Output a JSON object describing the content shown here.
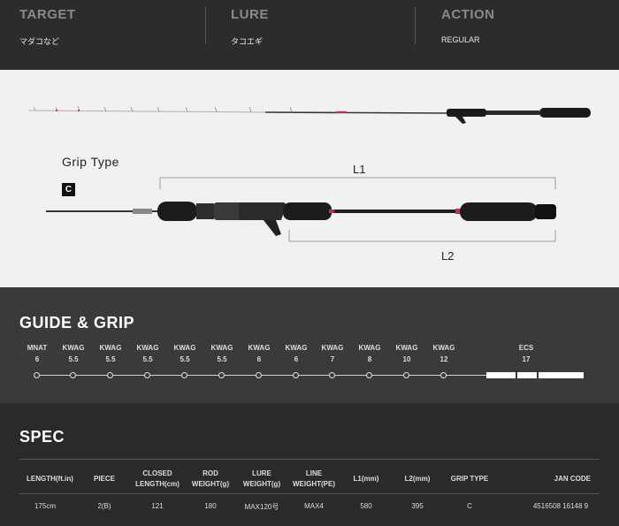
{
  "top": {
    "columns": [
      {
        "heading": "TARGET",
        "value": "マダコなど"
      },
      {
        "heading": "LURE",
        "value": "タコエギ"
      },
      {
        "heading": "ACTION",
        "value": "REGULAR"
      }
    ]
  },
  "rod": {
    "grip_type_label": "Grip Type",
    "grip_type_badge": "C",
    "l1_label": "L1",
    "l2_label": "L2"
  },
  "guide": {
    "title": "GUIDE & GRIP",
    "items": [
      {
        "name": "MNAT",
        "size": "6"
      },
      {
        "name": "KWAG",
        "size": "5.5"
      },
      {
        "name": "KWAG",
        "size": "5.5"
      },
      {
        "name": "KWAG",
        "size": "5.5"
      },
      {
        "name": "KWAG",
        "size": "5.5"
      },
      {
        "name": "KWAG",
        "size": "5.5"
      },
      {
        "name": "KWAG",
        "size": "6"
      },
      {
        "name": "KWAG",
        "size": "6"
      },
      {
        "name": "KWAG",
        "size": "7"
      },
      {
        "name": "KWAG",
        "size": "8"
      },
      {
        "name": "KWAG",
        "size": "10"
      },
      {
        "name": "KWAG",
        "size": "12"
      }
    ],
    "seat": {
      "name": "ECS",
      "size": "17"
    }
  },
  "spec": {
    "title": "SPEC",
    "headers": [
      "LENGTH(ft.in)",
      "PIECE",
      "CLOSED\nLENGTH(cm)",
      "ROD\nWEIGHT(g)",
      "LURE\nWEIGHT(g)",
      "LINE\nWEIGHT(PE)",
      "L1(mm)",
      "L2(mm)",
      "GRIP TYPE",
      "JAN CODE"
    ],
    "values": [
      "175cm",
      "2(B)",
      "121",
      "180",
      "MAX120号",
      "MAX4",
      "580",
      "395",
      "C",
      "4516508 16148 9"
    ]
  }
}
